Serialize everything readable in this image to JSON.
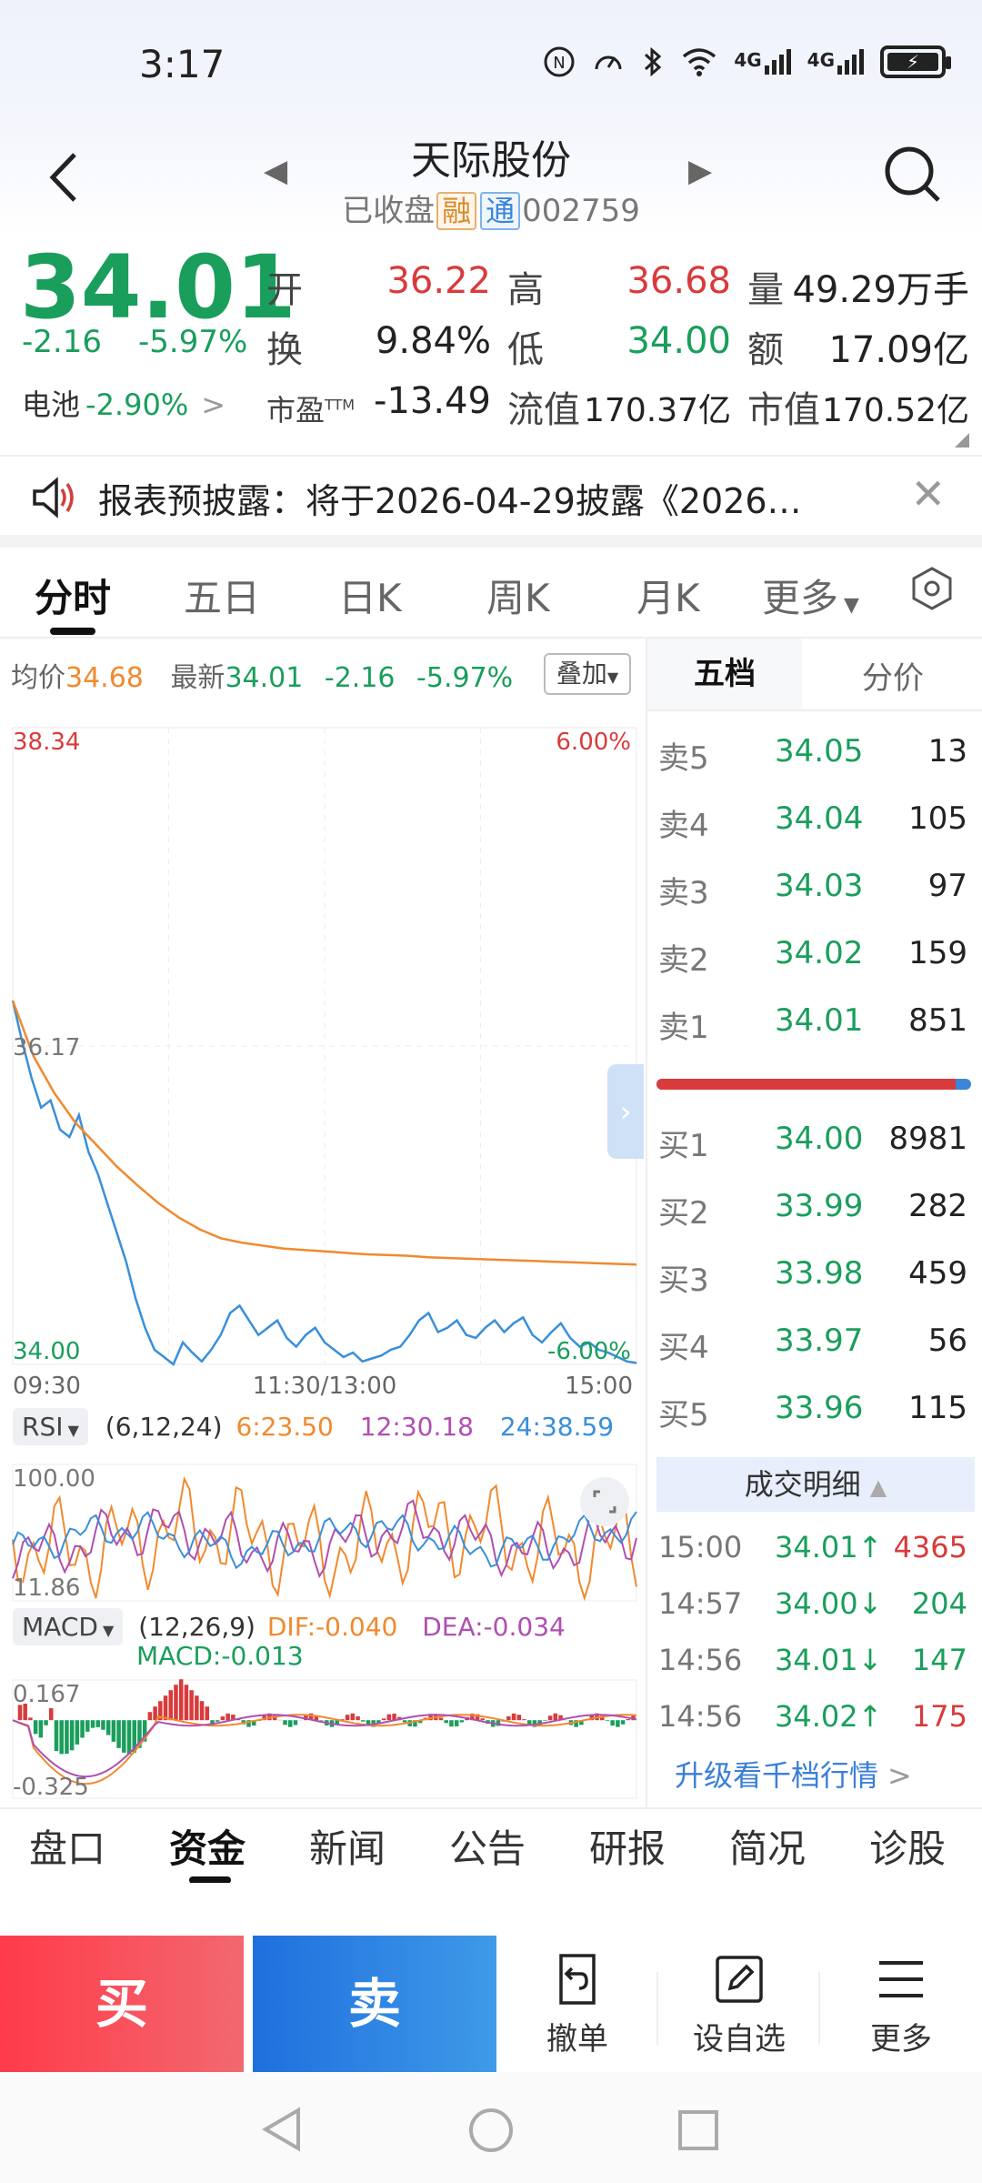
{
  "status_bar": {
    "time": "3:17",
    "icons": [
      "nfc-icon",
      "speed-icon",
      "bluetooth-icon",
      "wifi-icon",
      "signal-4g-icon",
      "signal-4g-icon",
      "battery-icon"
    ],
    "net1": "4G",
    "net2": "4G"
  },
  "header": {
    "name": "天际股份",
    "status": "已收盘",
    "tag_rong": "融",
    "tag_tong": "通",
    "code": "002759"
  },
  "quote": {
    "price": "34.01",
    "change": "-2.16",
    "change_pct": "-5.97%",
    "sector_name": "电池",
    "sector_pct": "-2.90%",
    "open_label": "开",
    "open": "36.22",
    "high_label": "高",
    "high": "36.68",
    "volume_label": "量",
    "volume": "49.29万手",
    "turnover_label": "换",
    "turnover": "9.84%",
    "low_label": "低",
    "low": "34.00",
    "amount_label": "额",
    "amount": "17.09亿",
    "pe_label": "市盈",
    "pe_sup": "TTM",
    "pe": "-13.49",
    "float_cap_label": "流值",
    "float_cap": "170.37亿",
    "mkt_cap_label": "市值",
    "mkt_cap": "170.52亿"
  },
  "notice": {
    "text": "报表预披露：将于2026-04-29披露《2026…"
  },
  "tabs": [
    "分时",
    "五日",
    "日K",
    "周K",
    "月K",
    "更多"
  ],
  "chart_info": {
    "avg_label": "均价",
    "avg": "34.68",
    "latest_label": "最新",
    "latest": "34.01",
    "chg": "-2.16",
    "pct": "-5.97%",
    "overlay_btn": "叠加"
  },
  "chart_data": {
    "type": "line",
    "title": "",
    "y_axis_labels": [
      "38.34",
      "36.17",
      "34.00"
    ],
    "pct_labels": [
      "6.00%",
      "-6.00%"
    ],
    "x_axis_labels": [
      "09:30",
      "11:30/13:00",
      "15:00"
    ],
    "ylim": [
      34.0,
      38.34
    ],
    "prev_close": 36.17,
    "series": [
      {
        "color": "#3a8fd9",
        "values": [
          36.48,
          36.2,
          35.95,
          35.75,
          35.8,
          35.6,
          35.55,
          35.7,
          35.45,
          35.3,
          35.1,
          34.9,
          34.7,
          34.45,
          34.25,
          34.1,
          34.05,
          34.0,
          34.15,
          34.08,
          34.02,
          34.1,
          34.2,
          34.35,
          34.4,
          34.3,
          34.2,
          34.25,
          34.3,
          34.18,
          34.12,
          34.2,
          34.25,
          34.15,
          34.1,
          34.05,
          34.08,
          34.02,
          34.04,
          34.06,
          34.1,
          34.12,
          34.2,
          34.3,
          34.35,
          34.22,
          34.25,
          34.3,
          34.2,
          34.18,
          34.25,
          34.3,
          34.22,
          34.28,
          34.32,
          34.2,
          34.15,
          34.22,
          34.28,
          34.18,
          34.12,
          34.15,
          34.1,
          34.08,
          34.05,
          34.02,
          34.01
        ]
      },
      {
        "color": "#f08a2f",
        "values": [
          36.48,
          36.1,
          35.85,
          35.65,
          35.5,
          35.35,
          35.22,
          35.1,
          35.0,
          34.92,
          34.86,
          34.83,
          34.81,
          34.79,
          34.78,
          34.77,
          34.76,
          34.75,
          34.745,
          34.74,
          34.73,
          34.725,
          34.72,
          34.715,
          34.71,
          34.705,
          34.7,
          34.695,
          34.69,
          34.685,
          34.68
        ]
      }
    ]
  },
  "rsi": {
    "name": "RSI",
    "params": "(6,12,24)",
    "rsi6": "6:23.50",
    "rsi12": "12:30.18",
    "rsi24": "24:38.59",
    "max": "100.00",
    "min": "11.86"
  },
  "macd": {
    "name": "MACD",
    "params": "(12,26,9)",
    "dif": "DIF:-0.040",
    "dea": "DEA:-0.034",
    "macd": "MACD:-0.013",
    "max": "0.167",
    "min": "-0.325"
  },
  "depth": {
    "tab_active": "五档",
    "tab_other": "分价",
    "asks": [
      {
        "label": "卖5",
        "price": "34.05",
        "vol": "13"
      },
      {
        "label": "卖4",
        "price": "34.04",
        "vol": "105"
      },
      {
        "label": "卖3",
        "price": "34.03",
        "vol": "97"
      },
      {
        "label": "卖2",
        "price": "34.02",
        "vol": "159"
      },
      {
        "label": "卖1",
        "price": "34.01",
        "vol": "851"
      }
    ],
    "bids": [
      {
        "label": "买1",
        "price": "34.00",
        "vol": "8981"
      },
      {
        "label": "买2",
        "price": "33.99",
        "vol": "282"
      },
      {
        "label": "买3",
        "price": "33.98",
        "vol": "459"
      },
      {
        "label": "买4",
        "price": "33.97",
        "vol": "56"
      },
      {
        "label": "买5",
        "price": "33.96",
        "vol": "115"
      }
    ],
    "buy_ratio": 0.95,
    "trades_title": "成交明细",
    "trades": [
      {
        "time": "15:00",
        "price": "34.01↑",
        "vol": "4365",
        "dir": "up"
      },
      {
        "time": "14:57",
        "price": "34.00↓",
        "vol": "204",
        "dir": "down"
      },
      {
        "time": "14:56",
        "price": "34.01↓",
        "vol": "147",
        "dir": "down"
      },
      {
        "time": "14:56",
        "price": "34.02↑",
        "vol": "175",
        "dir": "up"
      }
    ],
    "upgrade": "升级看千档行情"
  },
  "bottom_tabs": [
    "盘口",
    "资金",
    "新闻",
    "公告",
    "研报",
    "简况",
    "诊股"
  ],
  "actions": {
    "buy": "买",
    "sell": "卖",
    "cancel": "撤单",
    "watch": "设自选",
    "more": "更多"
  }
}
